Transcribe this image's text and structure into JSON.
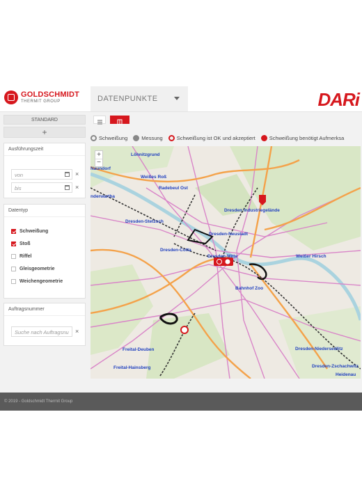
{
  "header": {
    "brand_line1": "GOLDSCHMIDT",
    "brand_line2": "THERMIT GROUP",
    "datapoints_select": "DATENPUNKTE",
    "app_logo": "DARi"
  },
  "sidebar": {
    "standard_label": "STANDARD",
    "add_label": "+",
    "execution_time": {
      "title": "Ausführungszeit",
      "from_placeholder": "von",
      "to_placeholder": "bis",
      "clear": "×"
    },
    "data_type": {
      "title": "Datentyp",
      "items": [
        {
          "label": "Schweißung",
          "checked": true
        },
        {
          "label": "Stoß",
          "checked": true
        },
        {
          "label": "Riffel",
          "checked": false
        },
        {
          "label": "Gleisgeometrie",
          "checked": false
        },
        {
          "label": "Weichengeometrie",
          "checked": false
        }
      ]
    },
    "order_number": {
      "title": "Auftragsnummer",
      "placeholder": "Suche nach Auftragsnu",
      "clear": "×"
    }
  },
  "legend": {
    "items": [
      {
        "label": "Schweißung",
        "icon": "weld-icon"
      },
      {
        "label": "Messung",
        "icon": "measure-icon"
      },
      {
        "label": "Schweißung ist OK und akzeptiert",
        "icon": "ok-icon"
      },
      {
        "label": "Schweißung benötigt Aufmerksa",
        "icon": "attention-icon"
      }
    ]
  },
  "map": {
    "zoom_in": "+",
    "zoom_out": "−",
    "places": [
      "Löhnitzgrund",
      "Naundorf",
      "Weißes Roß",
      "Radebeul Ost",
      "nderwartha",
      "Dresden Industriegelände",
      "Dresden-Stetzsch",
      "Dresden-Neustadt",
      "Dresden-Cotta",
      "Dresden-Mitte",
      "Weißer Hirsch",
      "Bahnhof Zoo",
      "Freital-Deuben",
      "Freital-Hainsberg",
      "Dresden-Niedersedlitz",
      "Dresden-Zschachwitz",
      "Heidenau"
    ]
  },
  "footer": {
    "text": "© 2019 - Goldschmidt Thermit Group"
  },
  "colors": {
    "brand_red": "#d6171d",
    "header_gray": "#f0f0f0",
    "footer": "#5a5a5a"
  }
}
